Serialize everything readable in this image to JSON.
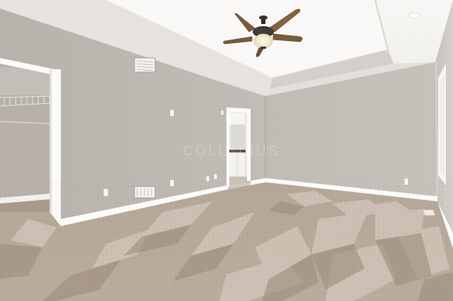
{
  "scene": {
    "kind": "photo-empty-bedroom",
    "watermark_text": "COLUMBUS",
    "colors": {
      "ceiling": "#f6f5f3",
      "tray_band": "#d9d4cf",
      "wall_left": "#bcb6b0",
      "wall_back": "#c3beb8",
      "wall_right": "#c9c4bf",
      "trim": "#fdfdfc",
      "carpet": "#b7aa9c",
      "carpet_light": "#d6ccc1",
      "carpet_dark": "#a09282",
      "fan_blade": "#7a5a3a",
      "fan_metal": "#3a332d"
    }
  }
}
